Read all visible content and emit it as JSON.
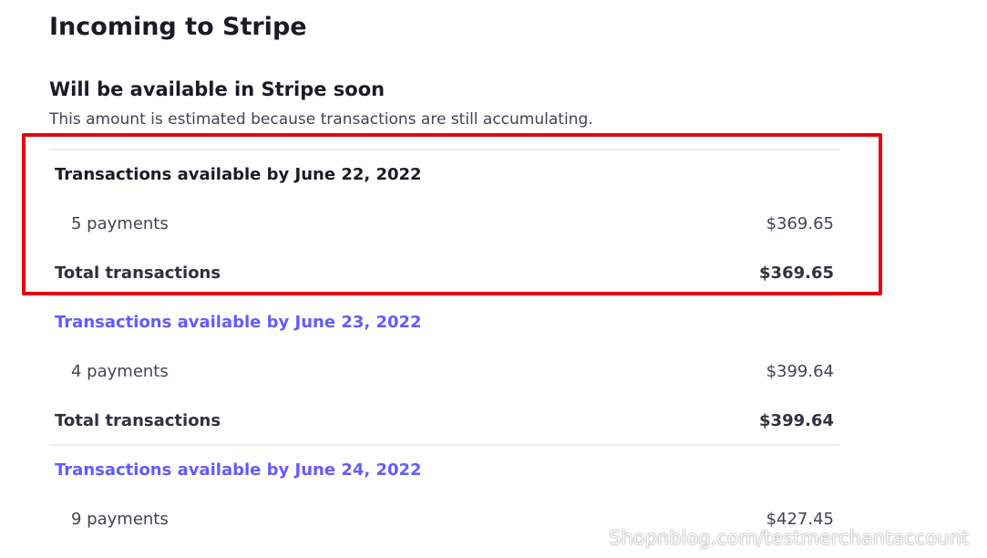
{
  "page": {
    "title": "Incoming to Stripe",
    "section_heading": "Will be available in Stripe soon",
    "section_note": "This amount is estimated because transactions are still accumulating."
  },
  "groups": [
    {
      "heading": "Transactions available by June 22, 2022",
      "payments_label": "5 payments",
      "payments_amount": "$369.65",
      "total_label": "Total transactions",
      "total_amount": "$369.65"
    },
    {
      "heading": "Transactions available by June 23, 2022",
      "payments_label": "4 payments",
      "payments_amount": "$399.64",
      "total_label": "Total transactions",
      "total_amount": "$399.64"
    },
    {
      "heading": "Transactions available by June 24, 2022",
      "payments_label": "9 payments",
      "payments_amount": "$427.45"
    }
  ],
  "watermark": "Shopnblog.com/testmerchantaccount",
  "colors": {
    "link": "#635bff",
    "highlight": "#e30613",
    "divider": "#ebeef1"
  }
}
